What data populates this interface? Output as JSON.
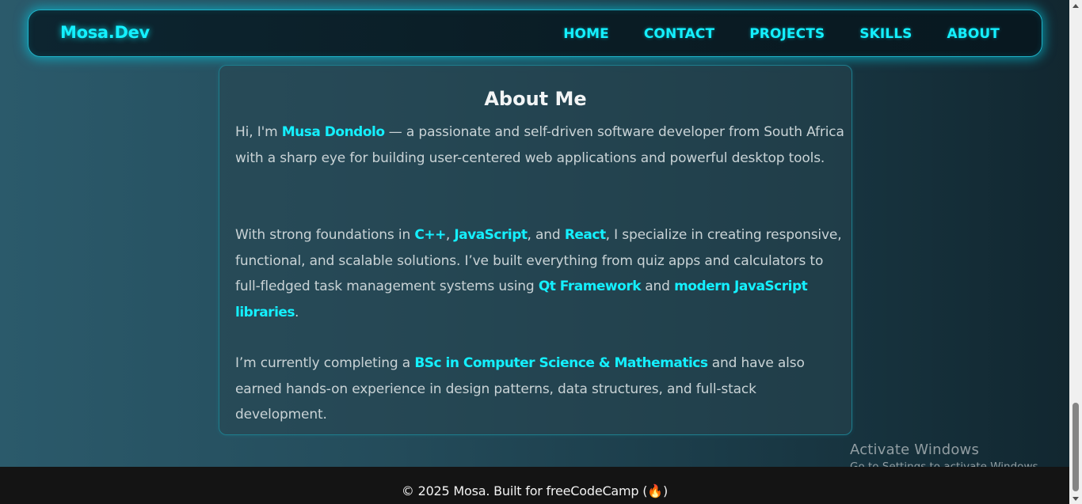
{
  "navbar": {
    "logo": "Mosa.Dev",
    "links": [
      "HOME",
      "CONTACT",
      "PROJECTS",
      "SKILLS",
      "ABOUT"
    ]
  },
  "about": {
    "title": "About Me",
    "p1": {
      "t1": "Hi, I'm ",
      "name": "Musa Dondolo",
      "t2": " — a passionate and self-driven software developer from South Africa with a sharp eye for building user-centered web applications and powerful desktop tools."
    },
    "p2": {
      "t1": "With strong foundations in ",
      "h1": "C++",
      "t2": ", ",
      "h2": "JavaScript",
      "t3": ", and ",
      "h3": "React",
      "t4": ", I specialize in creating responsive, functional, and scalable solutions. I’ve built everything from quiz apps and calculators to full-fledged task management systems using ",
      "h4": "Qt Framework",
      "t5": " and ",
      "h5": "modern JavaScript libraries",
      "t6": "."
    },
    "p3": {
      "t1": "I’m currently completing a ",
      "h1": "BSc in Computer Science & Mathematics",
      "t2": " and have also earned hands-on experience in design patterns, data structures, and full-stack development."
    }
  },
  "footer": {
    "text": "© 2025 Mosa. Built for freeCodeCamp (🔥)"
  },
  "watermark": {
    "title": "Activate Windows",
    "subtitle": "Go to Settings to activate Windows."
  },
  "colors": {
    "accent": "#14f0ff",
    "footer_bg": "#141414"
  },
  "scrollbar": {
    "position": "bottom"
  }
}
